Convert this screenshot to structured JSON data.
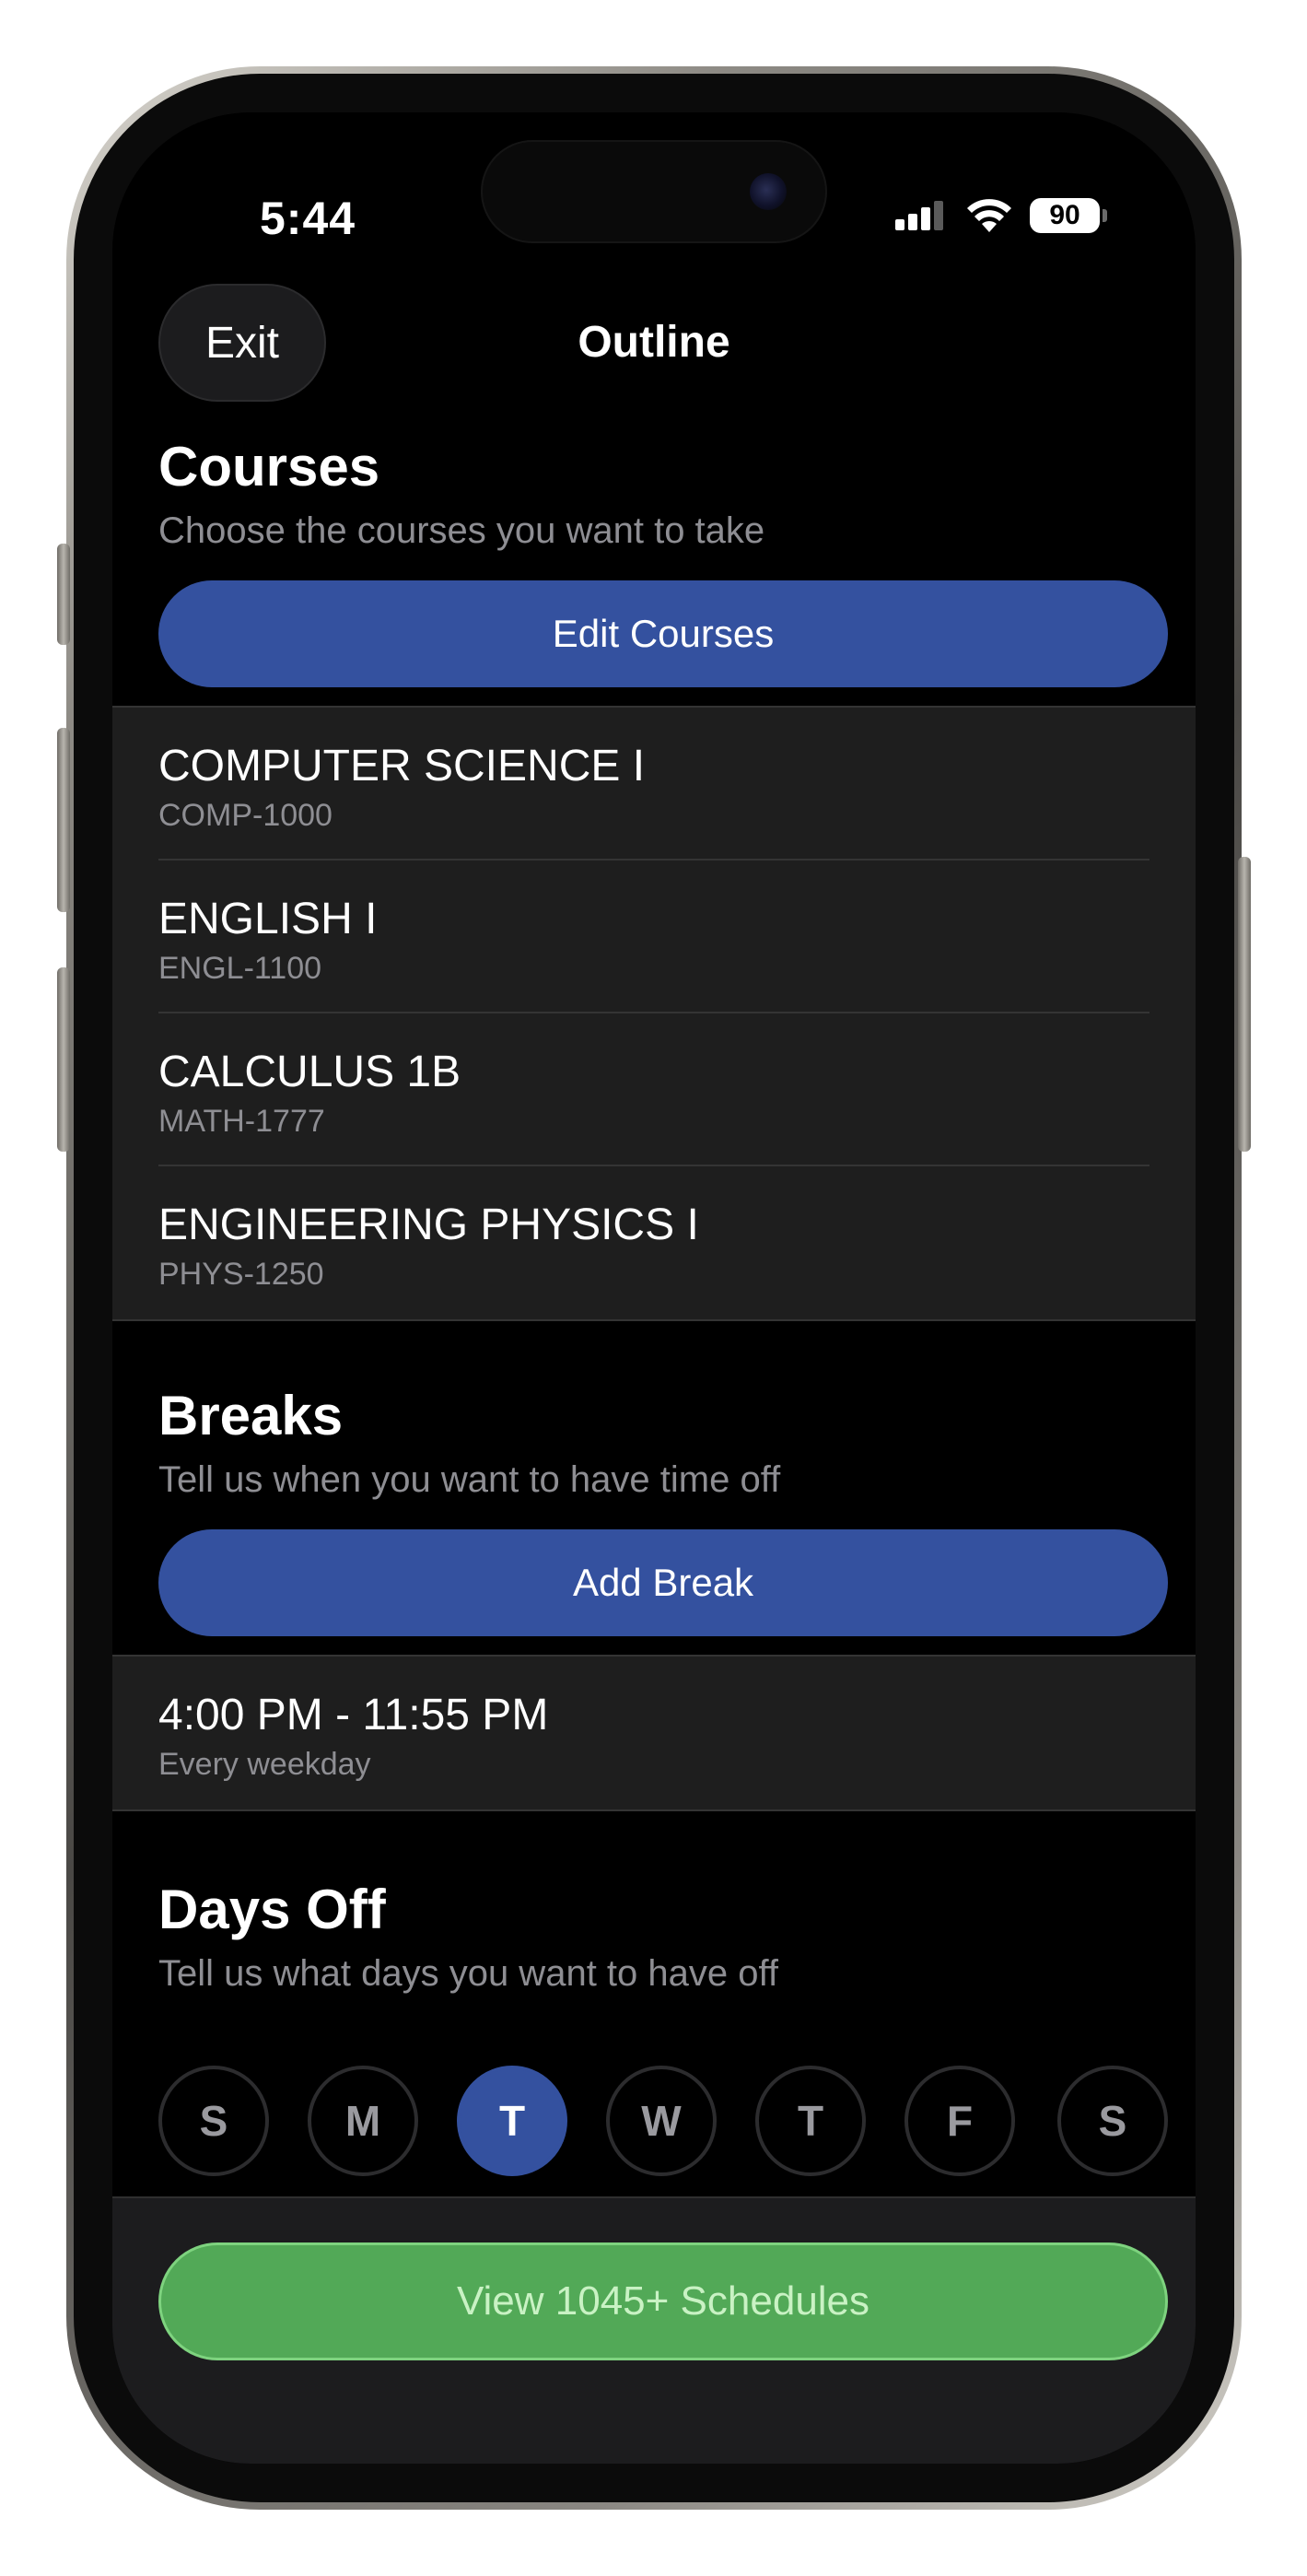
{
  "status_bar": {
    "time": "5:44",
    "battery": "90",
    "icons": [
      "signal-icon",
      "wifi-icon",
      "battery-icon"
    ]
  },
  "header": {
    "exit_label": "Exit",
    "title": "Outline"
  },
  "courses": {
    "title": "Courses",
    "subtitle": "Choose the courses you want to take",
    "button_label": "Edit Courses",
    "items": [
      {
        "name": "COMPUTER SCIENCE I",
        "code": "COMP-1000"
      },
      {
        "name": "ENGLISH I",
        "code": "ENGL-1100"
      },
      {
        "name": "CALCULUS 1B",
        "code": "MATH-1777"
      },
      {
        "name": "ENGINEERING PHYSICS I",
        "code": "PHYS-1250"
      }
    ]
  },
  "breaks": {
    "title": "Breaks",
    "subtitle": "Tell us when you want to have time off",
    "button_label": "Add Break",
    "items": [
      {
        "time": "4:00 PM - 11:55 PM",
        "repeat": "Every weekday"
      }
    ]
  },
  "days_off": {
    "title": "Days Off",
    "subtitle": "Tell us what days you want to have off",
    "days": [
      {
        "label": "S",
        "selected": false
      },
      {
        "label": "M",
        "selected": false
      },
      {
        "label": "T",
        "selected": true
      },
      {
        "label": "W",
        "selected": false
      },
      {
        "label": "T",
        "selected": false
      },
      {
        "label": "F",
        "selected": false
      },
      {
        "label": "S",
        "selected": false
      }
    ]
  },
  "footer": {
    "view_button_label": "View 1045+ Schedules"
  },
  "colors": {
    "accent_blue": "#34519f",
    "accent_green": "#52a957",
    "list_background": "#1e1e1e",
    "secondary_text": "#8e8e93"
  }
}
